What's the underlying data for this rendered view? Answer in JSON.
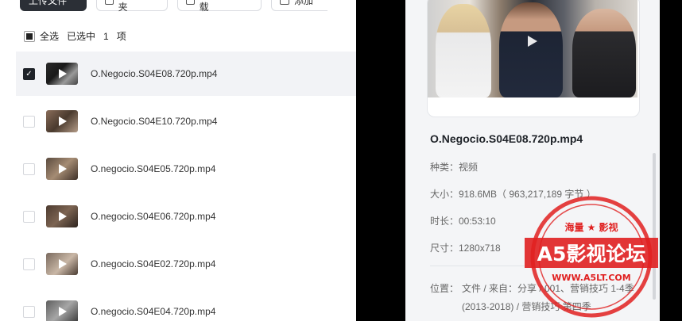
{
  "toolbar": {
    "upload_label": "上传文件",
    "new_folder_label": "新建文件夹",
    "offline_label": "BT/磁力链下载",
    "more_label": "添加"
  },
  "selection": {
    "all_label": "全选",
    "selected_prefix": "已选中",
    "count": "1",
    "unit": "项"
  },
  "files": [
    {
      "name": "O.Negocio.S04E08.720p.mp4",
      "selected": true
    },
    {
      "name": "O.Negocio.S04E10.720p.mp4",
      "selected": false
    },
    {
      "name": "O.negocio.S04E05.720p.mp4",
      "selected": false
    },
    {
      "name": "O.negocio.S04E06.720p.mp4",
      "selected": false
    },
    {
      "name": "O.negocio.S04E02.720p.mp4",
      "selected": false
    },
    {
      "name": "O.negocio.S04E04.720p.mp4",
      "selected": false
    }
  ],
  "detail": {
    "title": "O.Negocio.S04E08.720p.mp4",
    "type": "种类：视频",
    "size": "大小：918.6MB（ 963,217,189 字节 ）",
    "duration": "时长：00:53:10",
    "dimensions": "尺寸：1280x718",
    "location_label": "位置：",
    "location_value": "文件 / 来自：分享 / 001、营销技巧 1-4季 (2013-2018) / 营销技巧 第四季"
  },
  "watermark": {
    "top_text": "海量 ★ 影视",
    "main_text": "A5影视论坛",
    "url_text": "WWW.A5LT.COM"
  },
  "colors": {
    "selected_row": "#f2f3f6",
    "stamp_red": "#e02020",
    "panel_bg": "#f4f5f7"
  }
}
